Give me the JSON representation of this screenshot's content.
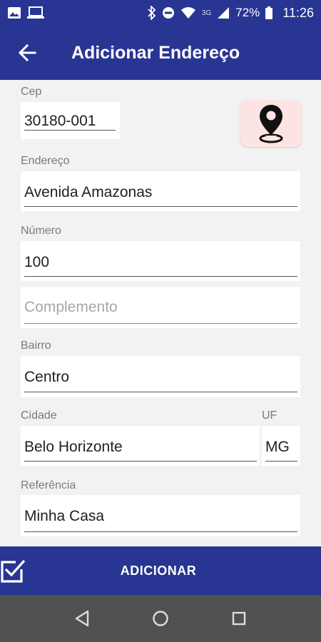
{
  "status_bar": {
    "network": "3G",
    "battery": "72%",
    "time": "11:26"
  },
  "app_bar": {
    "title": "Adicionar Endereço"
  },
  "form": {
    "cep": {
      "label": "Cep",
      "value": "30180-001"
    },
    "endereco": {
      "label": "Endereço",
      "value": "Avenida Amazonas"
    },
    "numero": {
      "label": "Número",
      "value": "100"
    },
    "complemento": {
      "placeholder": "Complemento",
      "value": ""
    },
    "bairro": {
      "label": "Bairro",
      "value": "Centro"
    },
    "cidade": {
      "label": "Cidade",
      "value": "Belo Horizonte"
    },
    "uf": {
      "label": "UF",
      "value": "MG"
    },
    "referencia": {
      "label": "Referência",
      "value": "Minha Casa"
    }
  },
  "action": {
    "label": "ADICIONAR"
  },
  "colors": {
    "primary": "#283593",
    "location_button_bg": "#fce4e2",
    "nav_bar": "#515151"
  }
}
